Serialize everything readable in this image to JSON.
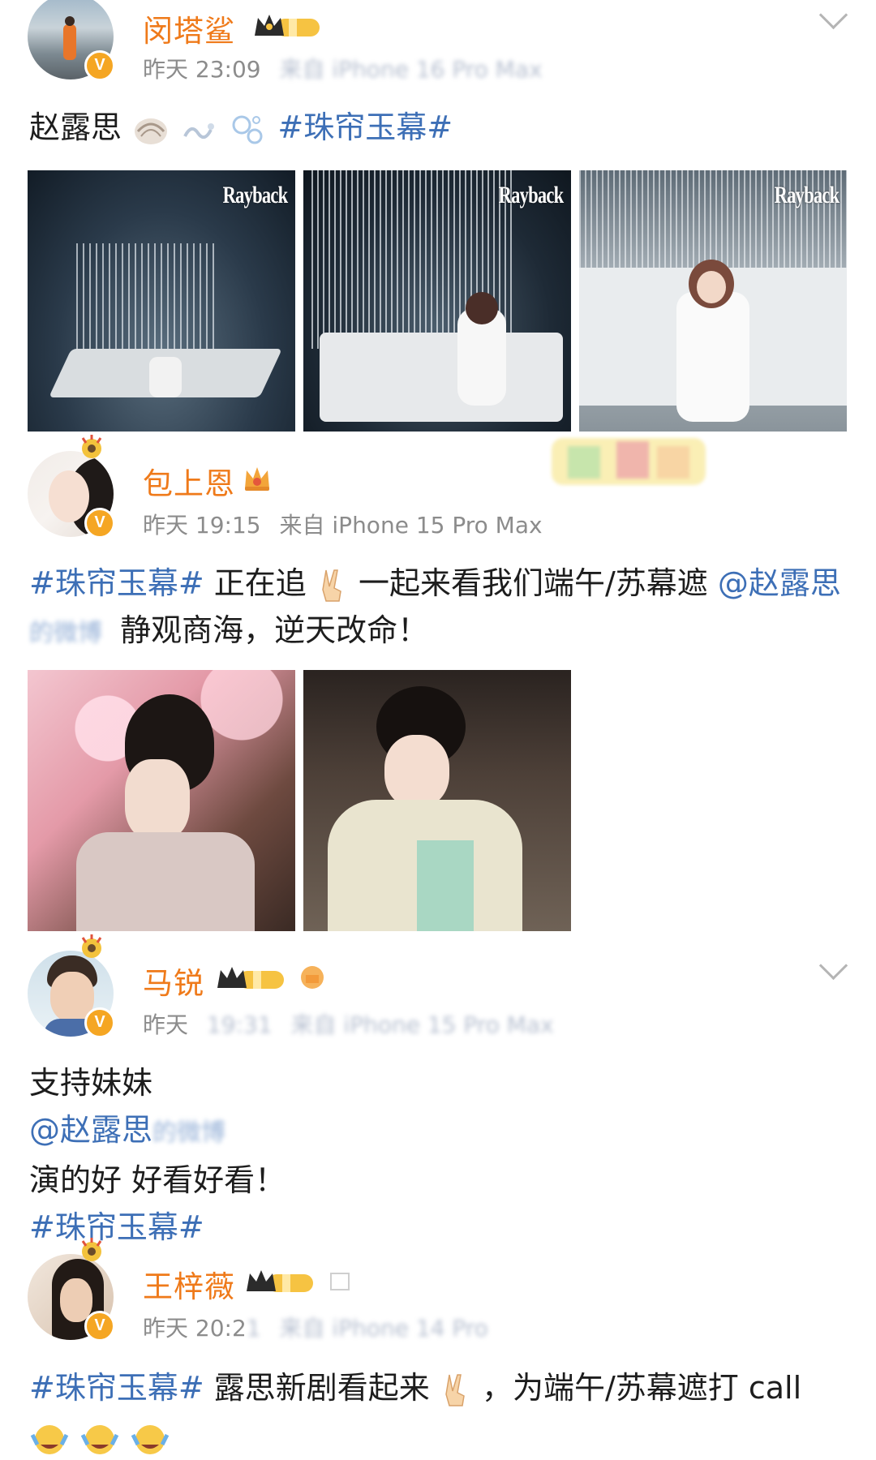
{
  "posts": [
    {
      "username": "闵塔鲨",
      "time": "昨天 23:09",
      "source_blur": "来自 iPhone 16 Pro Max",
      "text_plain": "赵露思",
      "hashtag": "#珠帘玉幕#",
      "images": [
        {
          "watermark": "Rayback",
          "icon": "photo-boat-wide"
        },
        {
          "watermark": "Rayback",
          "icon": "photo-boat-sitting"
        },
        {
          "watermark": "Rayback",
          "icon": "photo-boat-closeup"
        }
      ]
    },
    {
      "username": "包上恩",
      "time": "昨天 19:15",
      "source": "来自 iPhone 15 Pro Max",
      "hashtag": "#珠帘玉幕#",
      "text_1": "正在追",
      "text_2": "一起来看我们端午/苏幕遮",
      "mention": "@赵露思",
      "mention_blur": "的微博",
      "text_3": "静观商海，逆天改命！",
      "images": [
        {
          "icon": "photo-blossom-portrait"
        },
        {
          "icon": "photo-tea-portrait"
        }
      ]
    },
    {
      "username": "马锐",
      "time": "昨天",
      "time_blur": "19:31",
      "source_blur": "来自 iPhone 15 Pro Max",
      "line_1": "支持妹妹",
      "mention": "@赵露思",
      "mention_blur": "的微博",
      "line_2": "演的好 好看好看！",
      "hashtag": "#珠帘玉幕#"
    },
    {
      "username": "王梓薇",
      "time": "昨天 20:2",
      "time_blur": "1",
      "source_blur": "来自 iPhone 14 Pro",
      "hashtag": "#珠帘玉幕#",
      "text_1": "露思新剧看起来",
      "text_2": "，为端午/苏幕遮打 call"
    }
  ],
  "colors": {
    "username": "#ef7a1a",
    "link": "#3d6fb6",
    "meta": "#8c8c8c",
    "verified_badge": "#f5a623"
  }
}
